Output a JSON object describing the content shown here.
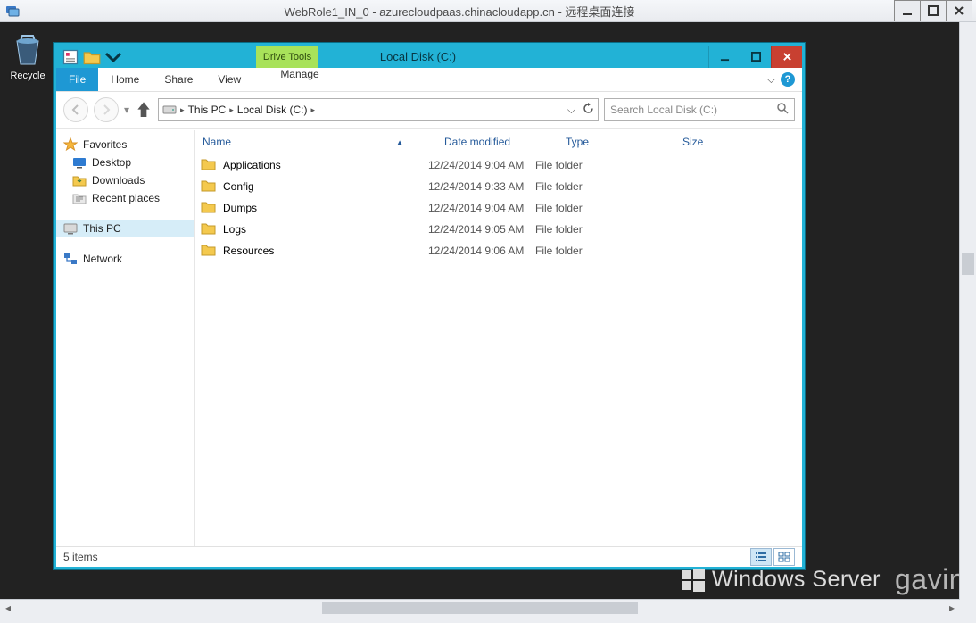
{
  "rdp": {
    "title": "WebRole1_IN_0 - azurecloudpaas.chinacloudapp.cn - 远程桌面连接"
  },
  "desktop": {
    "recycle_label": "Recycle",
    "watermark_brand": "Windows Server",
    "watermark_author": "gavin"
  },
  "explorer": {
    "drive_tools_label": "Drive Tools",
    "window_title": "Local Disk (C:)",
    "tabs": {
      "file": "File",
      "home": "Home",
      "share": "Share",
      "view": "View",
      "manage": "Manage"
    },
    "breadcrumbs": {
      "pc": "This PC",
      "drive": "Local Disk (C:)"
    },
    "search_placeholder": "Search Local Disk (C:)",
    "columns": {
      "name": "Name",
      "date": "Date modified",
      "type": "Type",
      "size": "Size"
    },
    "rows": [
      {
        "name": "Applications",
        "date": "12/24/2014 9:04 AM",
        "type": "File folder"
      },
      {
        "name": "Config",
        "date": "12/24/2014 9:33 AM",
        "type": "File folder"
      },
      {
        "name": "Dumps",
        "date": "12/24/2014 9:04 AM",
        "type": "File folder"
      },
      {
        "name": "Logs",
        "date": "12/24/2014 9:05 AM",
        "type": "File folder"
      },
      {
        "name": "Resources",
        "date": "12/24/2014 9:06 AM",
        "type": "File folder"
      }
    ],
    "sidebar": {
      "favorites_label": "Favorites",
      "desktop_label": "Desktop",
      "downloads_label": "Downloads",
      "recent_label": "Recent places",
      "thispc_label": "This PC",
      "network_label": "Network"
    },
    "status": "5 items"
  }
}
